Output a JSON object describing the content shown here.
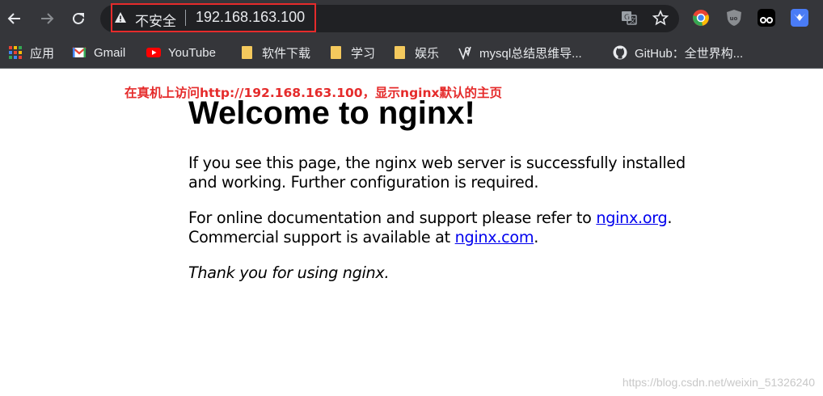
{
  "browser": {
    "address_bar": {
      "security_label": "不安全",
      "url": "192.168.163.100"
    },
    "icons": {
      "back": "arrow-left-icon",
      "forward": "arrow-right-icon",
      "reload": "reload-icon",
      "warning": "warning-triangle-icon",
      "translate": "translate-icon",
      "bookmark": "star-icon"
    },
    "extensions": [
      "chrome-color-icon",
      "ublock-icon",
      "tampermonkey-icon",
      "bookmark-extension-icon"
    ],
    "colors": {
      "toolbar": "#35363a",
      "omnibox": "#202124",
      "highlight": "#e52b2b"
    }
  },
  "bookmarks": [
    {
      "label": "应用",
      "icon": "apps-grid-icon"
    },
    {
      "label": "Gmail",
      "icon": "gmail-icon"
    },
    {
      "label": "YouTube",
      "icon": "youtube-icon"
    },
    {
      "label": "软件下载",
      "icon": "folder-icon"
    },
    {
      "label": "学习",
      "icon": "folder-icon"
    },
    {
      "label": "娱乐",
      "icon": "folder-icon"
    },
    {
      "label": "mysql总结思维导...",
      "icon": "site-icon"
    },
    {
      "label": "GitHub：全世界构...",
      "icon": "github-icon"
    }
  ],
  "annotation": "在真机上访问http://192.168.163.100，显示nginx默认的主页",
  "page": {
    "title": "Welcome to nginx!",
    "p1": "If you see this page, the nginx web server is successfully installed and working. Further configuration is required.",
    "p2_prefix": "For online documentation and support please refer to ",
    "p2_link1": "nginx.org",
    "p2_mid": ".",
    "p2_line2": "Commercial support is available at ",
    "p2_link2": "nginx.com",
    "p2_end": ".",
    "p3": "Thank you for using nginx."
  },
  "watermark": "https://blog.csdn.net/weixin_51326240"
}
